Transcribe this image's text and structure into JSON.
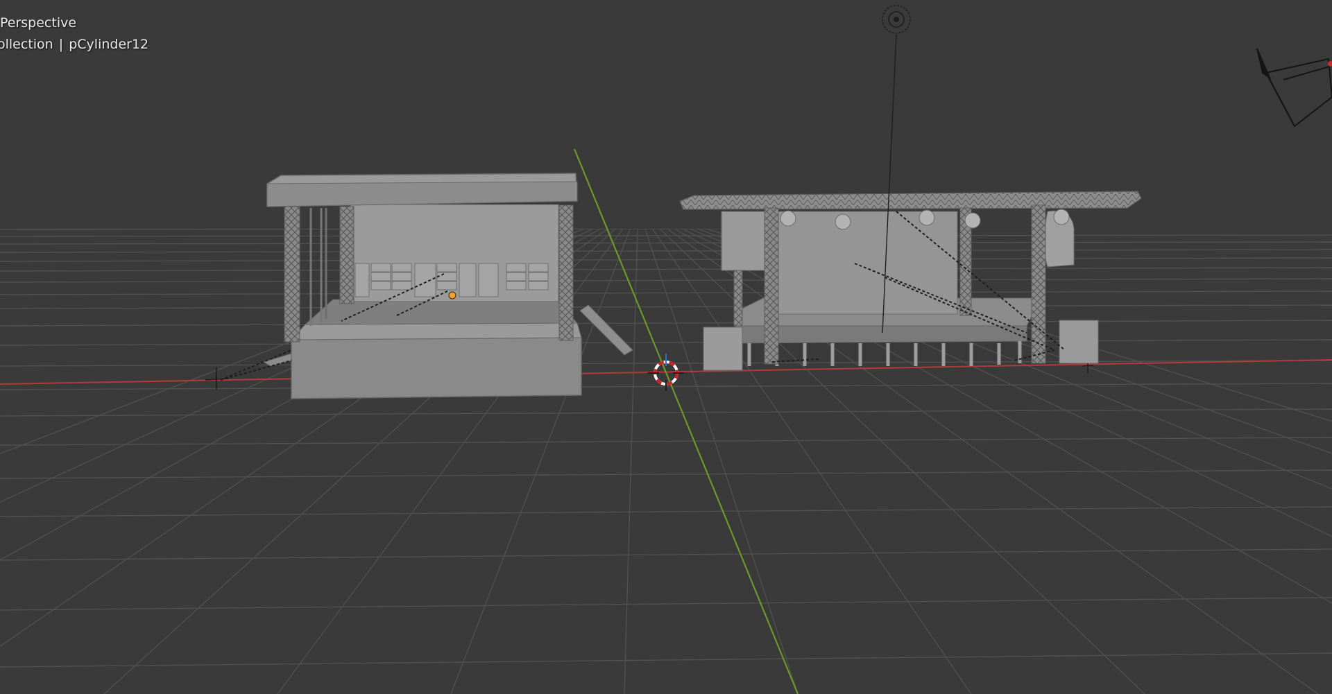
{
  "viewport": {
    "view_mode": "Perspective",
    "collection_label": "ollection",
    "separator": "|",
    "active_object": "pCylinder12"
  },
  "scene": {
    "objects": [
      {
        "name": "stage-left",
        "type": "stage"
      },
      {
        "name": "stage-right",
        "type": "stage"
      },
      {
        "name": "light",
        "type": "light"
      },
      {
        "name": "camera",
        "type": "camera"
      },
      {
        "name": "3d-cursor",
        "type": "cursor"
      }
    ]
  },
  "colors": {
    "background": "#3a3a3a",
    "grid": "#505050",
    "x_axis": "#b33a3a",
    "y_axis": "#6b9a2a",
    "mesh": "#8c8c8c",
    "mesh_dark": "#6e6e6e",
    "mesh_light": "#a8a8a8",
    "cursor_red": "#d02020",
    "origin_orange": "#f0a030"
  }
}
